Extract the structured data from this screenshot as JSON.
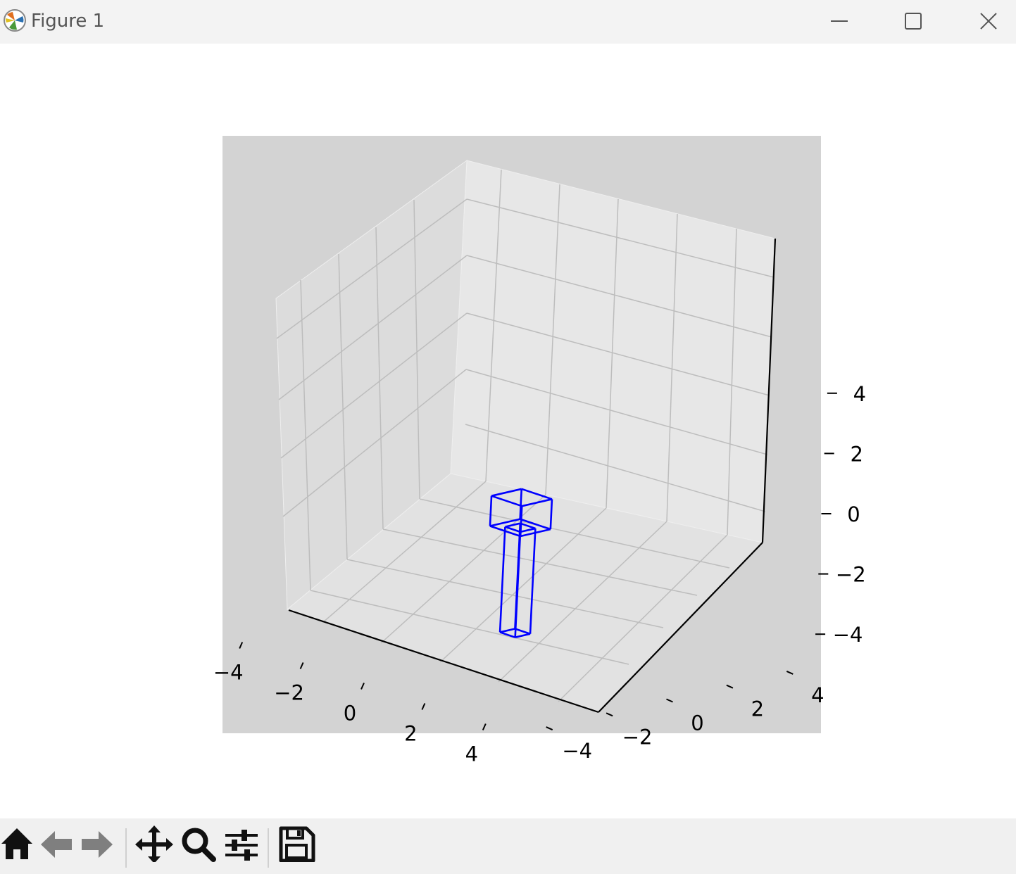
{
  "window": {
    "title": "Figure 1",
    "controls": [
      "minimize",
      "maximize",
      "close"
    ]
  },
  "toolbar": {
    "tools": [
      {
        "name": "home",
        "icon": "home-icon"
      },
      {
        "name": "back",
        "icon": "arrow-left-icon"
      },
      {
        "name": "forward",
        "icon": "arrow-right-icon"
      },
      {
        "name": "pan",
        "icon": "move-icon"
      },
      {
        "name": "zoom",
        "icon": "magnifier-icon"
      },
      {
        "name": "configure-subplots",
        "icon": "sliders-icon"
      },
      {
        "name": "save",
        "icon": "floppy-disk-icon"
      }
    ]
  },
  "colors": {
    "accent": "#0000ff",
    "panel": "#d3d3d3",
    "pane": "#e5e5e5",
    "grid": "#bfbfbf"
  },
  "chart_data": {
    "type": "line",
    "projection": "3d",
    "x_ticks": [
      "−4",
      "−2",
      "0",
      "2",
      "4"
    ],
    "y_ticks": [
      "−4",
      "−2",
      "0",
      "2",
      "4"
    ],
    "z_ticks": [
      "−4",
      "−2",
      "0",
      "2",
      "4"
    ],
    "xlim": [
      -5,
      5
    ],
    "ylim": [
      -5,
      5
    ],
    "zlim": [
      -5,
      5
    ],
    "grid": true,
    "series": [
      {
        "shape": "wireframe-box",
        "color": "#0000ff",
        "x": [
          -0.5,
          0.5
        ],
        "y": [
          -0.5,
          0.5
        ],
        "z": [
          -1.0,
          0.0
        ]
      },
      {
        "shape": "wireframe-box",
        "color": "#0000ff",
        "x": [
          -0.25,
          0.25
        ],
        "y": [
          -0.25,
          0.25
        ],
        "z": [
          -4.5,
          -1.0
        ]
      }
    ]
  }
}
